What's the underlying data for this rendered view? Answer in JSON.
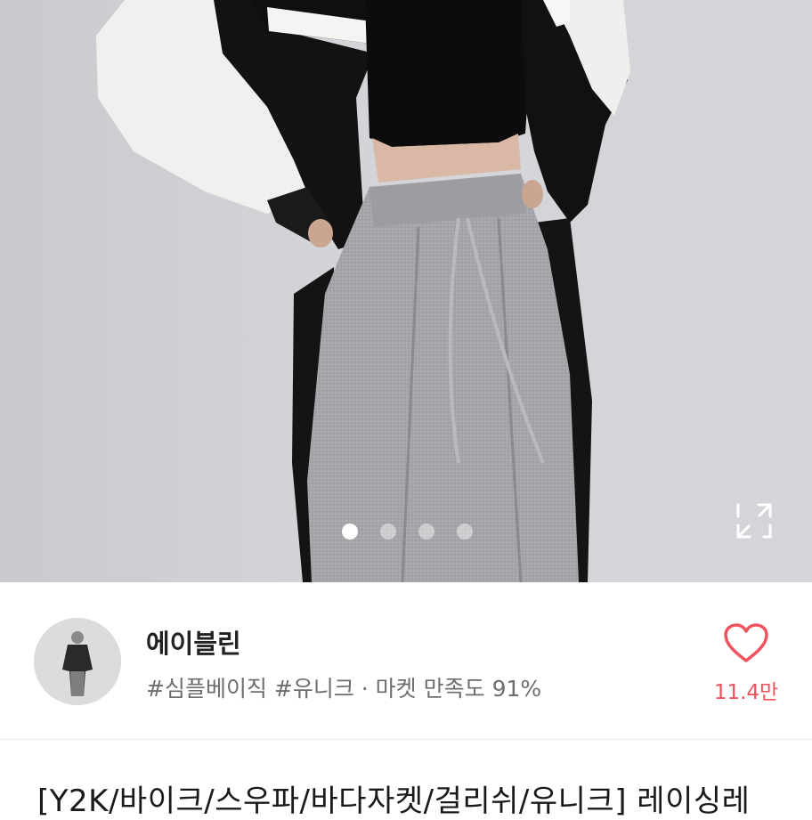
{
  "product": {
    "image_count": 4,
    "active_image_index": 0,
    "title": "[Y2K/바이크/스우파/바다자켓/걸리쉬/유니크] 레이싱레"
  },
  "seller": {
    "name": "에이블린",
    "tags": "#심플베이직 #유니크 · 마켓 만족도 91%",
    "likes": "11.4만"
  },
  "icons": {
    "expand": "expand-icon",
    "heart": "heart-outline-icon"
  },
  "colors": {
    "accent": "#f0525e",
    "text_primary": "#222222",
    "text_secondary": "#6e6e6e"
  }
}
